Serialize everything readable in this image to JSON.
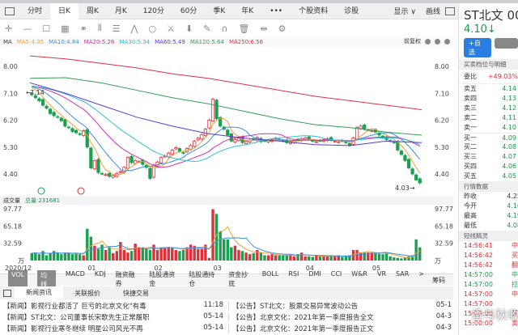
{
  "tabs": [
    "分时",
    "日K",
    "周K",
    "月K",
    "120分",
    "60分",
    "季K",
    "年K",
    "•••",
    "个股资料",
    "诊股"
  ],
  "tab_active": 1,
  "tab_right": {
    "display": "显示 ∨",
    "draw": "画线"
  },
  "ma_legend": {
    "label": "MA",
    "items": [
      {
        "t": "MA5:4.35",
        "c": "#f0a030"
      },
      {
        "t": "MA10:4.84",
        "c": "#3a8ee0"
      },
      {
        "t": "MA20:5.26",
        "c": "#d030b0"
      },
      {
        "t": "MA30:5.34",
        "c": "#30c0d0"
      },
      {
        "t": "MA60:5.49",
        "c": "#5a3ad0"
      },
      {
        "t": "MA120:5.64",
        "c": "#30a050"
      },
      {
        "t": "MA250:6.56",
        "c": "#e03040"
      }
    ],
    "adjust": "前复权"
  },
  "volume": {
    "label": "成交量",
    "total": "总量:231681",
    "unit": "万"
  },
  "indicator_tabs": [
    "VOL",
    "均线",
    "MACD",
    "KDJ",
    "融资融券",
    "陆股通资金",
    "陆股通持仓",
    "资金抄底",
    "BOLL",
    "RSI",
    "DMI",
    "CCI",
    "W&R",
    "VR",
    "SAR",
    ">"
  ],
  "chips": "筹码",
  "news_tabs": [
    "新闻资讯",
    "关联报价",
    "快捷交易"
  ],
  "news": [
    {
      "l": "【新闻】影视行业都活了 巨亏的北京文化\"有毒",
      "lt": "11:18",
      "r": "【公告】ST北文：股票交易异常波动公告",
      "rt": "05-1"
    },
    {
      "l": "【新闻】ST北文：公司董事长宋歌先生正常履职",
      "lt": "05-14",
      "r": "【公告】北京文化：2021年第一季度报告全文",
      "rt": "04-3"
    },
    {
      "l": "【新闻】影视行业寒冬继续 明星公司风光不再",
      "lt": "05-14",
      "r": "【公告】北京文化：2021年第一季度报告正文",
      "rt": "04-3"
    }
  ],
  "stock": {
    "name": "ST北文",
    "code_frag": "00",
    "price": "4.10",
    "arrow": "↓",
    "add_btn": "+自选"
  },
  "orderbook": {
    "title": "买卖档位与明细",
    "ratio_label": "委比",
    "ratio": "+49.03%",
    "rows": [
      [
        "卖五",
        "4.14"
      ],
      [
        "卖四",
        "4.13"
      ],
      [
        "卖三",
        "4.12"
      ],
      [
        "卖二",
        "4.11"
      ],
      [
        "卖一",
        "4.10"
      ],
      [
        "买一",
        "4.09"
      ],
      [
        "买二",
        "4.08"
      ],
      [
        "买三",
        "4.07"
      ],
      [
        "买四",
        "4.06"
      ],
      [
        "买五",
        "4.05"
      ]
    ]
  },
  "market": {
    "title": "行情数据",
    "rows": [
      [
        "昨收",
        "4.25",
        "#333"
      ],
      [
        "今开",
        "4.16",
        "#1a9a4a"
      ],
      [
        "最高",
        "4.19",
        "#1a9a4a"
      ],
      [
        "最低",
        "4.08",
        "#1a9a4a"
      ]
    ]
  },
  "elf": {
    "title": "短线精灵",
    "rows": [
      [
        "14:56:41",
        "中",
        "#e0303a"
      ],
      [
        "14:56:42",
        "买",
        "#e0303a"
      ],
      [
        "14:56:42",
        "翻",
        "#e0303a"
      ],
      [
        "14:57:00",
        "中",
        "#1a9a4a"
      ],
      [
        "14:57:00",
        "拉",
        "#1a9a4a"
      ],
      [
        "14:57:00",
        "中",
        "#e0303a"
      ],
      [
        "14:57:00",
        "",
        "#e0303a"
      ],
      [
        "15:00:00",
        "买",
        "#e0303a"
      ],
      [
        "15:00:00",
        "卖",
        "#e0303a"
      ]
    ]
  },
  "watermark": "香与秋收",
  "chart_data": {
    "type": "candlestick",
    "price_ticks": [
      "8.00",
      "7.10",
      "6.20",
      "5.30",
      "4.40"
    ],
    "price_tick_values": [
      8.0,
      7.1,
      6.2,
      5.3,
      4.4
    ],
    "ylim": [
      3.9,
      8.45
    ],
    "vol_ticks": [
      "97.77",
      "65.18",
      "32.59",
      "万"
    ],
    "vol_max": 97.77,
    "x_labels": [
      {
        "t": "2020/12",
        "i": 0
      },
      {
        "t": "01",
        "i": 16
      },
      {
        "t": "02",
        "i": 34
      },
      {
        "t": "03",
        "i": 50
      },
      {
        "t": "04",
        "i": 75
      },
      {
        "t": "05",
        "i": 93
      }
    ],
    "annotations": {
      "high": "7.14",
      "low": "4.03"
    },
    "close": [
      7.05,
      6.95,
      6.85,
      6.7,
      6.6,
      6.42,
      6.35,
      6.3,
      6.18,
      6.0,
      5.95,
      5.82,
      5.78,
      5.72,
      5.85,
      5.3,
      4.6,
      4.85,
      4.45,
      4.4,
      4.38,
      4.32,
      4.35,
      4.42,
      4.48,
      4.62,
      4.95,
      4.78,
      4.85,
      4.82,
      4.72,
      4.62,
      4.25,
      4.7,
      4.8,
      4.95,
      5.0,
      5.1,
      5.2,
      5.28,
      5.15,
      5.1,
      5.25,
      5.35,
      5.5,
      5.6,
      5.72,
      5.9,
      6.2,
      6.9,
      6.25,
      6.0,
      5.9,
      5.7,
      5.5,
      5.55,
      5.6,
      5.45,
      5.5,
      5.52,
      5.55,
      5.62,
      5.48,
      5.5,
      5.52,
      5.55,
      5.6,
      5.55,
      5.5,
      5.45,
      5.48,
      5.52,
      5.55,
      5.58,
      5.6,
      5.55,
      5.5,
      5.48,
      5.52,
      5.55,
      5.58,
      5.52,
      5.5,
      5.48,
      5.5,
      5.45,
      5.35,
      5.6,
      5.95,
      6.0,
      5.9,
      5.88,
      5.85,
      5.8,
      5.7,
      5.6,
      5.55,
      5.5,
      5.45,
      5.2,
      5.05,
      4.85,
      4.6,
      4.4,
      4.2,
      4.1
    ],
    "volume": [
      14,
      15,
      12,
      18,
      10,
      14,
      18,
      14,
      12,
      15,
      14,
      12,
      14,
      12,
      10,
      60,
      45,
      28,
      22,
      30,
      20,
      25,
      14,
      18,
      35,
      20,
      15,
      18,
      32,
      25,
      25,
      22,
      20,
      30,
      20,
      25,
      25,
      25,
      25,
      20,
      18,
      20,
      25,
      30,
      28,
      22,
      22,
      30,
      5,
      97,
      88,
      55,
      40,
      40,
      25,
      28,
      20,
      18,
      15,
      12,
      14,
      20,
      15,
      10,
      10,
      12,
      10,
      10,
      10,
      10,
      12,
      8,
      12,
      15,
      8,
      8,
      7,
      10,
      8,
      8,
      8,
      10,
      8,
      10,
      7,
      8,
      10,
      20,
      20,
      15,
      15,
      15,
      15,
      15,
      13,
      12,
      15,
      8,
      6,
      5,
      4,
      6,
      8,
      10,
      40,
      25
    ],
    "ma60": [
      7.45,
      7.1,
      6.7,
      6.3,
      6.0,
      5.75,
      5.6,
      5.5,
      5.38,
      5.35,
      5.5,
      5.45
    ],
    "ma120": [
      7.6,
      7.62,
      7.45,
      7.2,
      6.95,
      6.75,
      6.5,
      6.25,
      6.05,
      5.95,
      5.8,
      5.7
    ],
    "ma250": [
      8.35,
      8.25,
      8.1,
      7.95,
      7.75,
      7.6,
      7.4,
      7.2,
      7.0,
      6.85,
      6.7,
      6.55
    ]
  }
}
